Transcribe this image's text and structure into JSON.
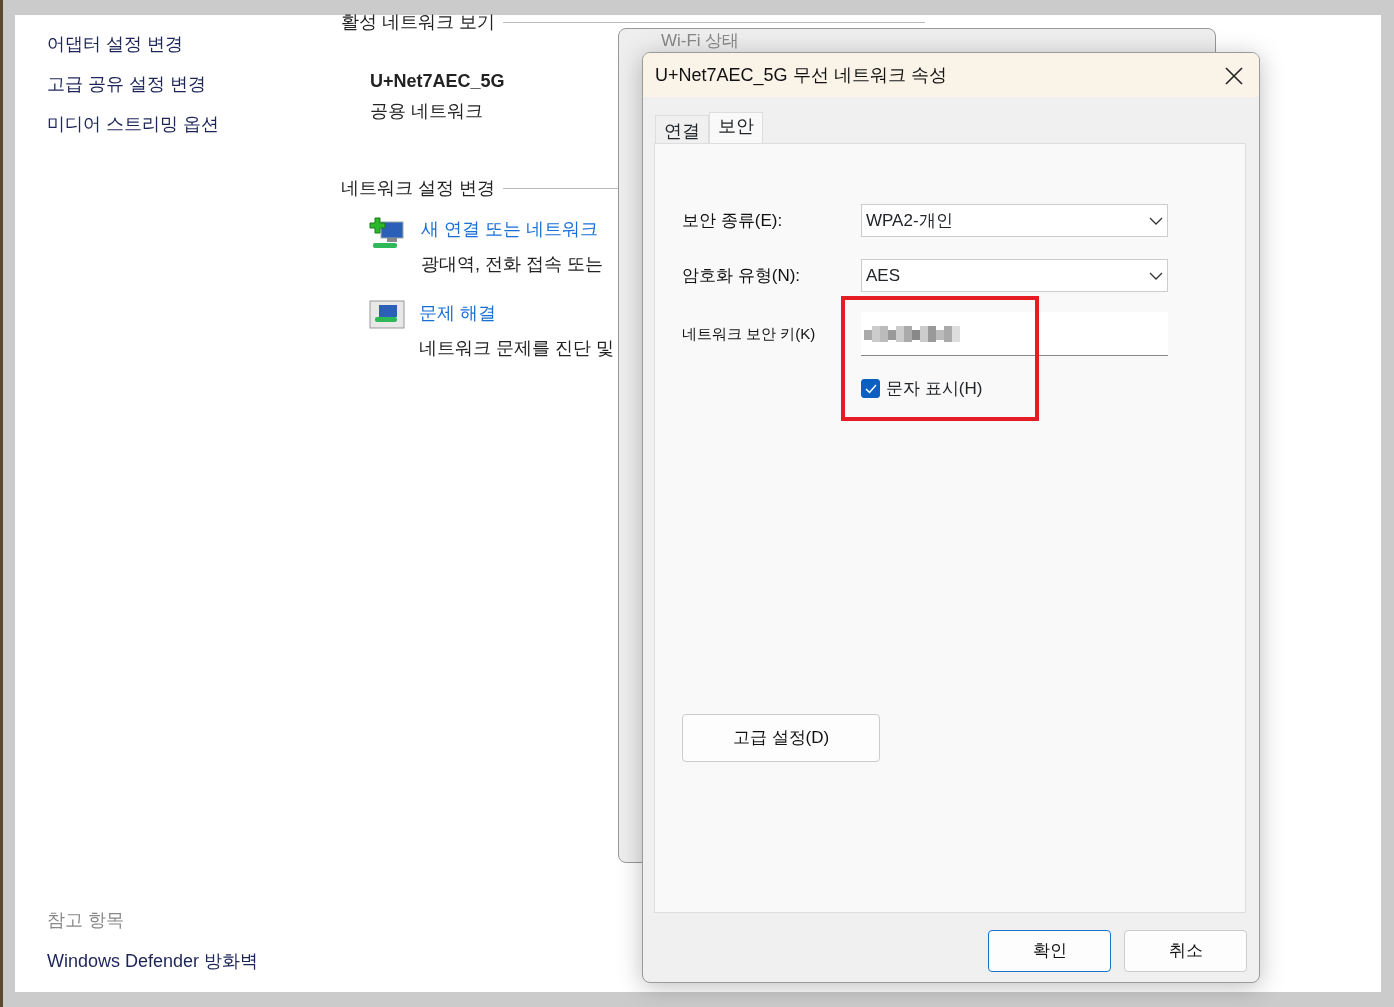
{
  "sidebar": {
    "links": [
      "어댑터 설정 변경",
      "고급 공유 설정 변경",
      "미디어 스트리밍 옵션"
    ],
    "see_also": {
      "heading": "참고 항목",
      "links": [
        "Windows Defender 방화벽"
      ]
    }
  },
  "active_networks": {
    "heading": "활성 네트워크 보기",
    "network": {
      "name": "U+Net7AEC_5G",
      "category": "공용 네트워크"
    }
  },
  "change_settings": {
    "heading": "네트워크 설정 변경",
    "tasks": [
      {
        "kind": "new-connection",
        "link": "새 연결 또는 네트워크",
        "description": "광대역, 전화 접속 또는"
      },
      {
        "kind": "troubleshoot",
        "link": "문제 해결",
        "description": "네트워크 문제를 진단 및"
      }
    ]
  },
  "status_window": {
    "title": "Wi-Fi 상태"
  },
  "dialog": {
    "title": "U+Net7AEC_5G 무선 네트워크 속성",
    "tabs": [
      {
        "label": "연결",
        "selected": false
      },
      {
        "label": "보안",
        "selected": true
      }
    ],
    "fields": [
      {
        "kind": "select",
        "label": "보안 종류(E):",
        "value": "WPA2-개인"
      },
      {
        "kind": "select",
        "label": "암호화 유형(N):",
        "value": "AES"
      },
      {
        "kind": "password",
        "label": "네트워크 보안 키(K)"
      }
    ],
    "show_characters": {
      "label": "문자 표시(H)",
      "checked": true
    },
    "advanced_button": "고급 설정(D)",
    "buttons": [
      {
        "label": "확인",
        "default": true
      },
      {
        "label": "취소",
        "default": false
      }
    ]
  }
}
